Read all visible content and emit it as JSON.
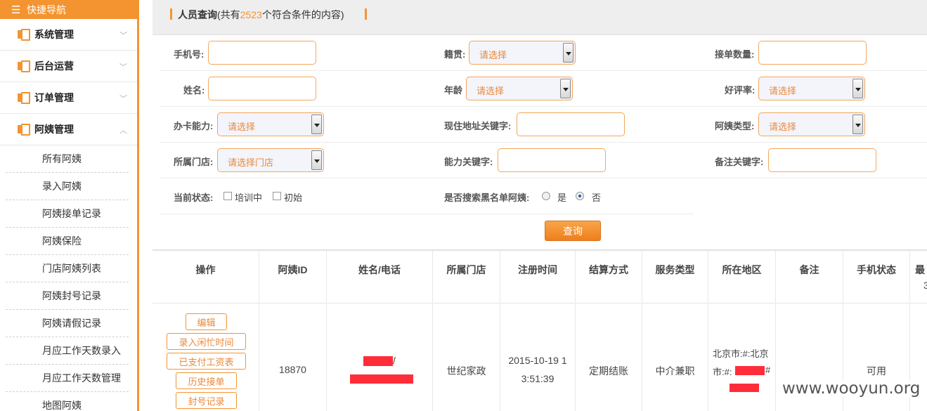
{
  "sidebar": {
    "quicknav": "快捷导航",
    "groups": [
      {
        "label": "系统管理",
        "chevron": "﹀"
      },
      {
        "label": "后台运营",
        "chevron": "﹀"
      },
      {
        "label": "订单管理",
        "chevron": "﹀"
      },
      {
        "label": "阿姨管理",
        "chevron": "︿"
      }
    ],
    "sub_items": [
      "所有阿姨",
      "录入阿姨",
      "阿姨接单记录",
      "阿姨保险",
      "门店阿姨列表",
      "阿姨封号记录",
      "阿姨请假记录",
      "月应工作天数录入",
      "月应工作天数管理",
      "地图阿姨"
    ]
  },
  "header": {
    "title": "人员查询",
    "count_prefix": "(共有",
    "count": "2523",
    "count_suffix": "个符合条件的内容)"
  },
  "form": {
    "phone_label": "手机号:",
    "native_label": "籍贯:",
    "native_value": "请选择",
    "orders_label": "接单数量:",
    "name_label": "姓名:",
    "age_label": "年龄",
    "age_value": "请选择",
    "rating_label": "好评率:",
    "rating_value": "请选择",
    "card_label": "办卡能力:",
    "card_value": "请选择",
    "address_label": "现住地址关键字:",
    "type_label": "阿姨类型:",
    "type_value": "请选择",
    "store_label": "所属门店:",
    "store_value": "请选择门店",
    "ability_label": "能力关键字:",
    "note_label": "备注关键字:",
    "status_label": "当前状态:",
    "status_opt1": "培训中",
    "status_opt2": "初始",
    "blacklist_label": "是否搜索黑名单阿姨:",
    "blacklist_yes": "是",
    "blacklist_no": "否",
    "query_button": "查询"
  },
  "table": {
    "headers": [
      "操作",
      "阿姨ID",
      "姓名/电话",
      "所属门店",
      "注册时间",
      "结算方式",
      "服务类型",
      "所在地区",
      "备注",
      "手机状态",
      "最"
    ],
    "header_tail_2": "3",
    "row": {
      "actions": [
        "编辑",
        "录入闲忙时间",
        "已支付工资表",
        "历史接单",
        "封号记录"
      ],
      "id": "18870",
      "name_sep": "/",
      "store": "世纪家政",
      "reg_time_line1": "2015-10-19 1",
      "reg_time_line2": "3:51:39",
      "settlement": "定期结账",
      "service": "中介兼职",
      "region_line1": "北京市:#:北京",
      "region_line2_prefix": "市:#:",
      "region_line2_suffix": "#",
      "phone_status": "可用"
    }
  },
  "watermark": "www.wooyun.org"
}
